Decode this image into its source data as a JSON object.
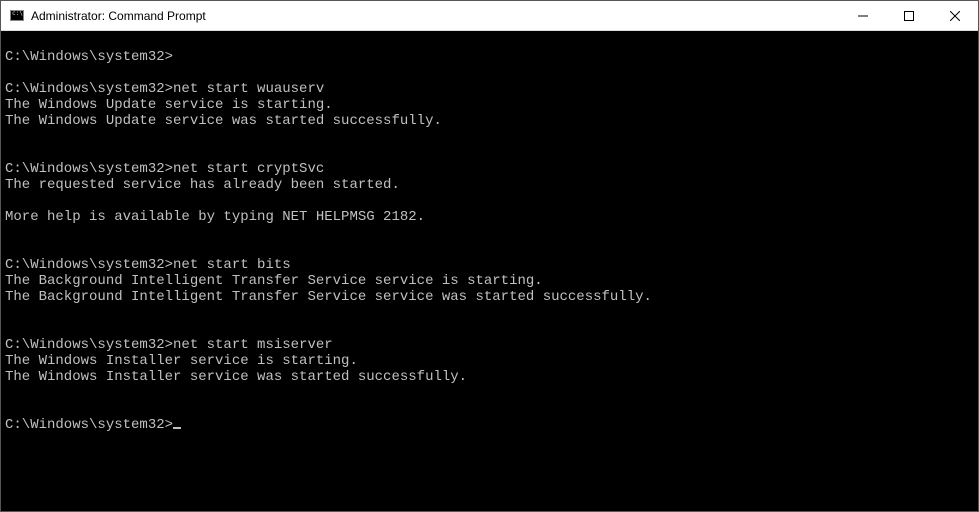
{
  "window": {
    "title": "Administrator: Command Prompt"
  },
  "terminal": {
    "lines": [
      "",
      "C:\\Windows\\system32>",
      "",
      "C:\\Windows\\system32>net start wuauserv",
      "The Windows Update service is starting.",
      "The Windows Update service was started successfully.",
      "",
      "",
      "C:\\Windows\\system32>net start cryptSvc",
      "The requested service has already been started.",
      "",
      "More help is available by typing NET HELPMSG 2182.",
      "",
      "",
      "C:\\Windows\\system32>net start bits",
      "The Background Intelligent Transfer Service service is starting.",
      "The Background Intelligent Transfer Service service was started successfully.",
      "",
      "",
      "C:\\Windows\\system32>net start msiserver",
      "The Windows Installer service is starting.",
      "The Windows Installer service was started successfully.",
      "",
      "",
      "C:\\Windows\\system32>"
    ]
  }
}
